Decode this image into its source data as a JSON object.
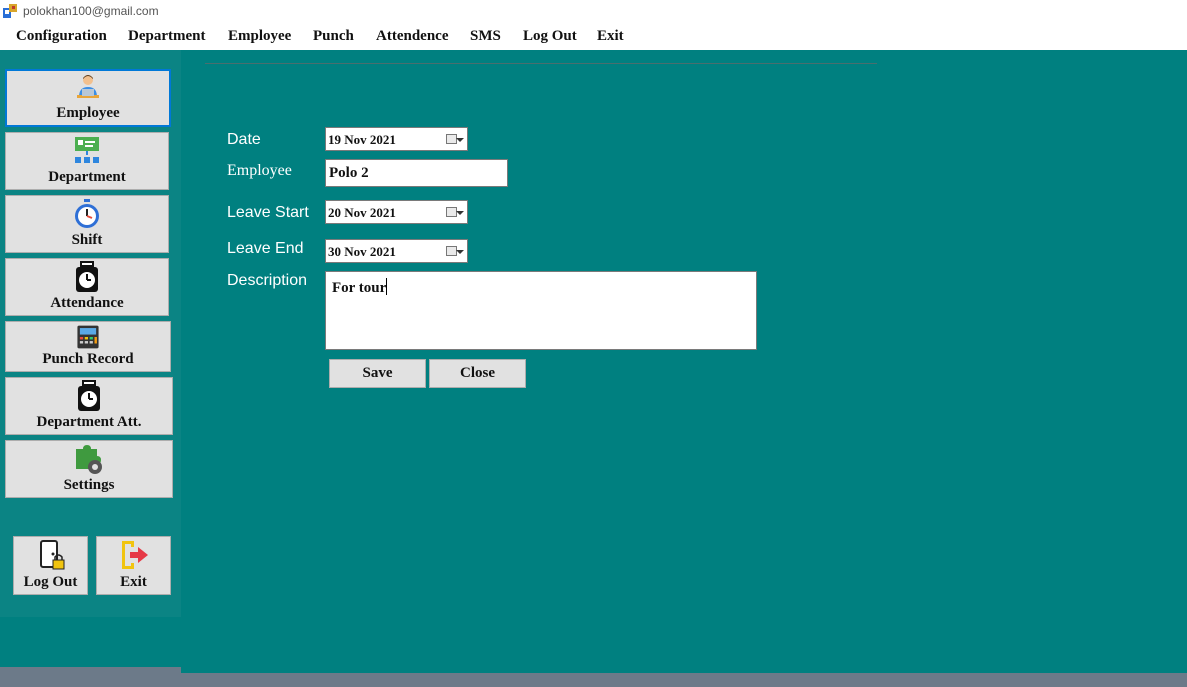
{
  "window": {
    "title": "polokhan100@gmail.com"
  },
  "menu": [
    "Configuration",
    "Department",
    "Employee",
    "Punch",
    "Attendence",
    "SMS",
    "Log Out",
    "Exit"
  ],
  "sidebar": {
    "items": [
      {
        "label": "Employee",
        "icon": "employee-icon"
      },
      {
        "label": "Department",
        "icon": "department-icon"
      },
      {
        "label": "Shift",
        "icon": "stopwatch-icon"
      },
      {
        "label": "Attendance",
        "icon": "time-clock-icon"
      },
      {
        "label": "Punch Record",
        "icon": "punch-machine-icon"
      },
      {
        "label": "Department Att.",
        "icon": "time-clock-icon"
      },
      {
        "label": "Settings",
        "icon": "puzzle-gear-icon"
      }
    ],
    "logout_label": "Log Out",
    "exit_label": "Exit"
  },
  "form": {
    "date_label": "Date",
    "date_value": "19 Nov 2021",
    "employee_label": "Employee",
    "employee_value": "Polo 2",
    "leave_start_label": "Leave Start",
    "leave_start_value": "20 Nov 2021",
    "leave_end_label": "Leave End",
    "leave_end_value": "30 Nov 2021",
    "description_label": "Description",
    "description_value": "For tour",
    "save_label": "Save",
    "close_label": "Close"
  },
  "colors": {
    "background": "#008080",
    "sidebar": "#0b8484",
    "button": "#e1e1e1",
    "active_border": "#0078d7"
  }
}
